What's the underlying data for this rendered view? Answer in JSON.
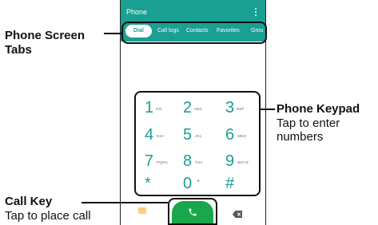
{
  "app": {
    "title": "Phone"
  },
  "tabs": [
    "Dial",
    "Call logs",
    "Contacts",
    "Favorites",
    "Grou"
  ],
  "keypad": [
    {
      "digit": "1",
      "letters": "GO"
    },
    {
      "digit": "2",
      "letters": "ABC"
    },
    {
      "digit": "3",
      "letters": "DEF"
    },
    {
      "digit": "4",
      "letters": "GHI"
    },
    {
      "digit": "5",
      "letters": "JKL"
    },
    {
      "digit": "6",
      "letters": "MNO"
    },
    {
      "digit": "7",
      "letters": "PQRS"
    },
    {
      "digit": "8",
      "letters": "TUV"
    },
    {
      "digit": "9",
      "letters": "WXYZ"
    },
    {
      "digit": "*",
      "letters": ""
    },
    {
      "digit": "0",
      "letters": "+"
    },
    {
      "digit": "#",
      "letters": ""
    }
  ],
  "callouts": {
    "tabs_title_line1": "Phone Screen",
    "tabs_title_line2": "Tabs",
    "keypad_title": "Phone Keypad",
    "keypad_desc_line1": "Tap to enter",
    "keypad_desc_line2": "numbers",
    "callkey_title": "Call Key",
    "callkey_desc": "Tap to place call"
  },
  "colors": {
    "header": "#1a9f93",
    "call": "#1aa64a",
    "accent": "#1a9f93"
  },
  "icons": {
    "call": "phone-icon",
    "menu": "more-vert-icon",
    "message": "message-icon",
    "delete": "backspace-icon"
  }
}
